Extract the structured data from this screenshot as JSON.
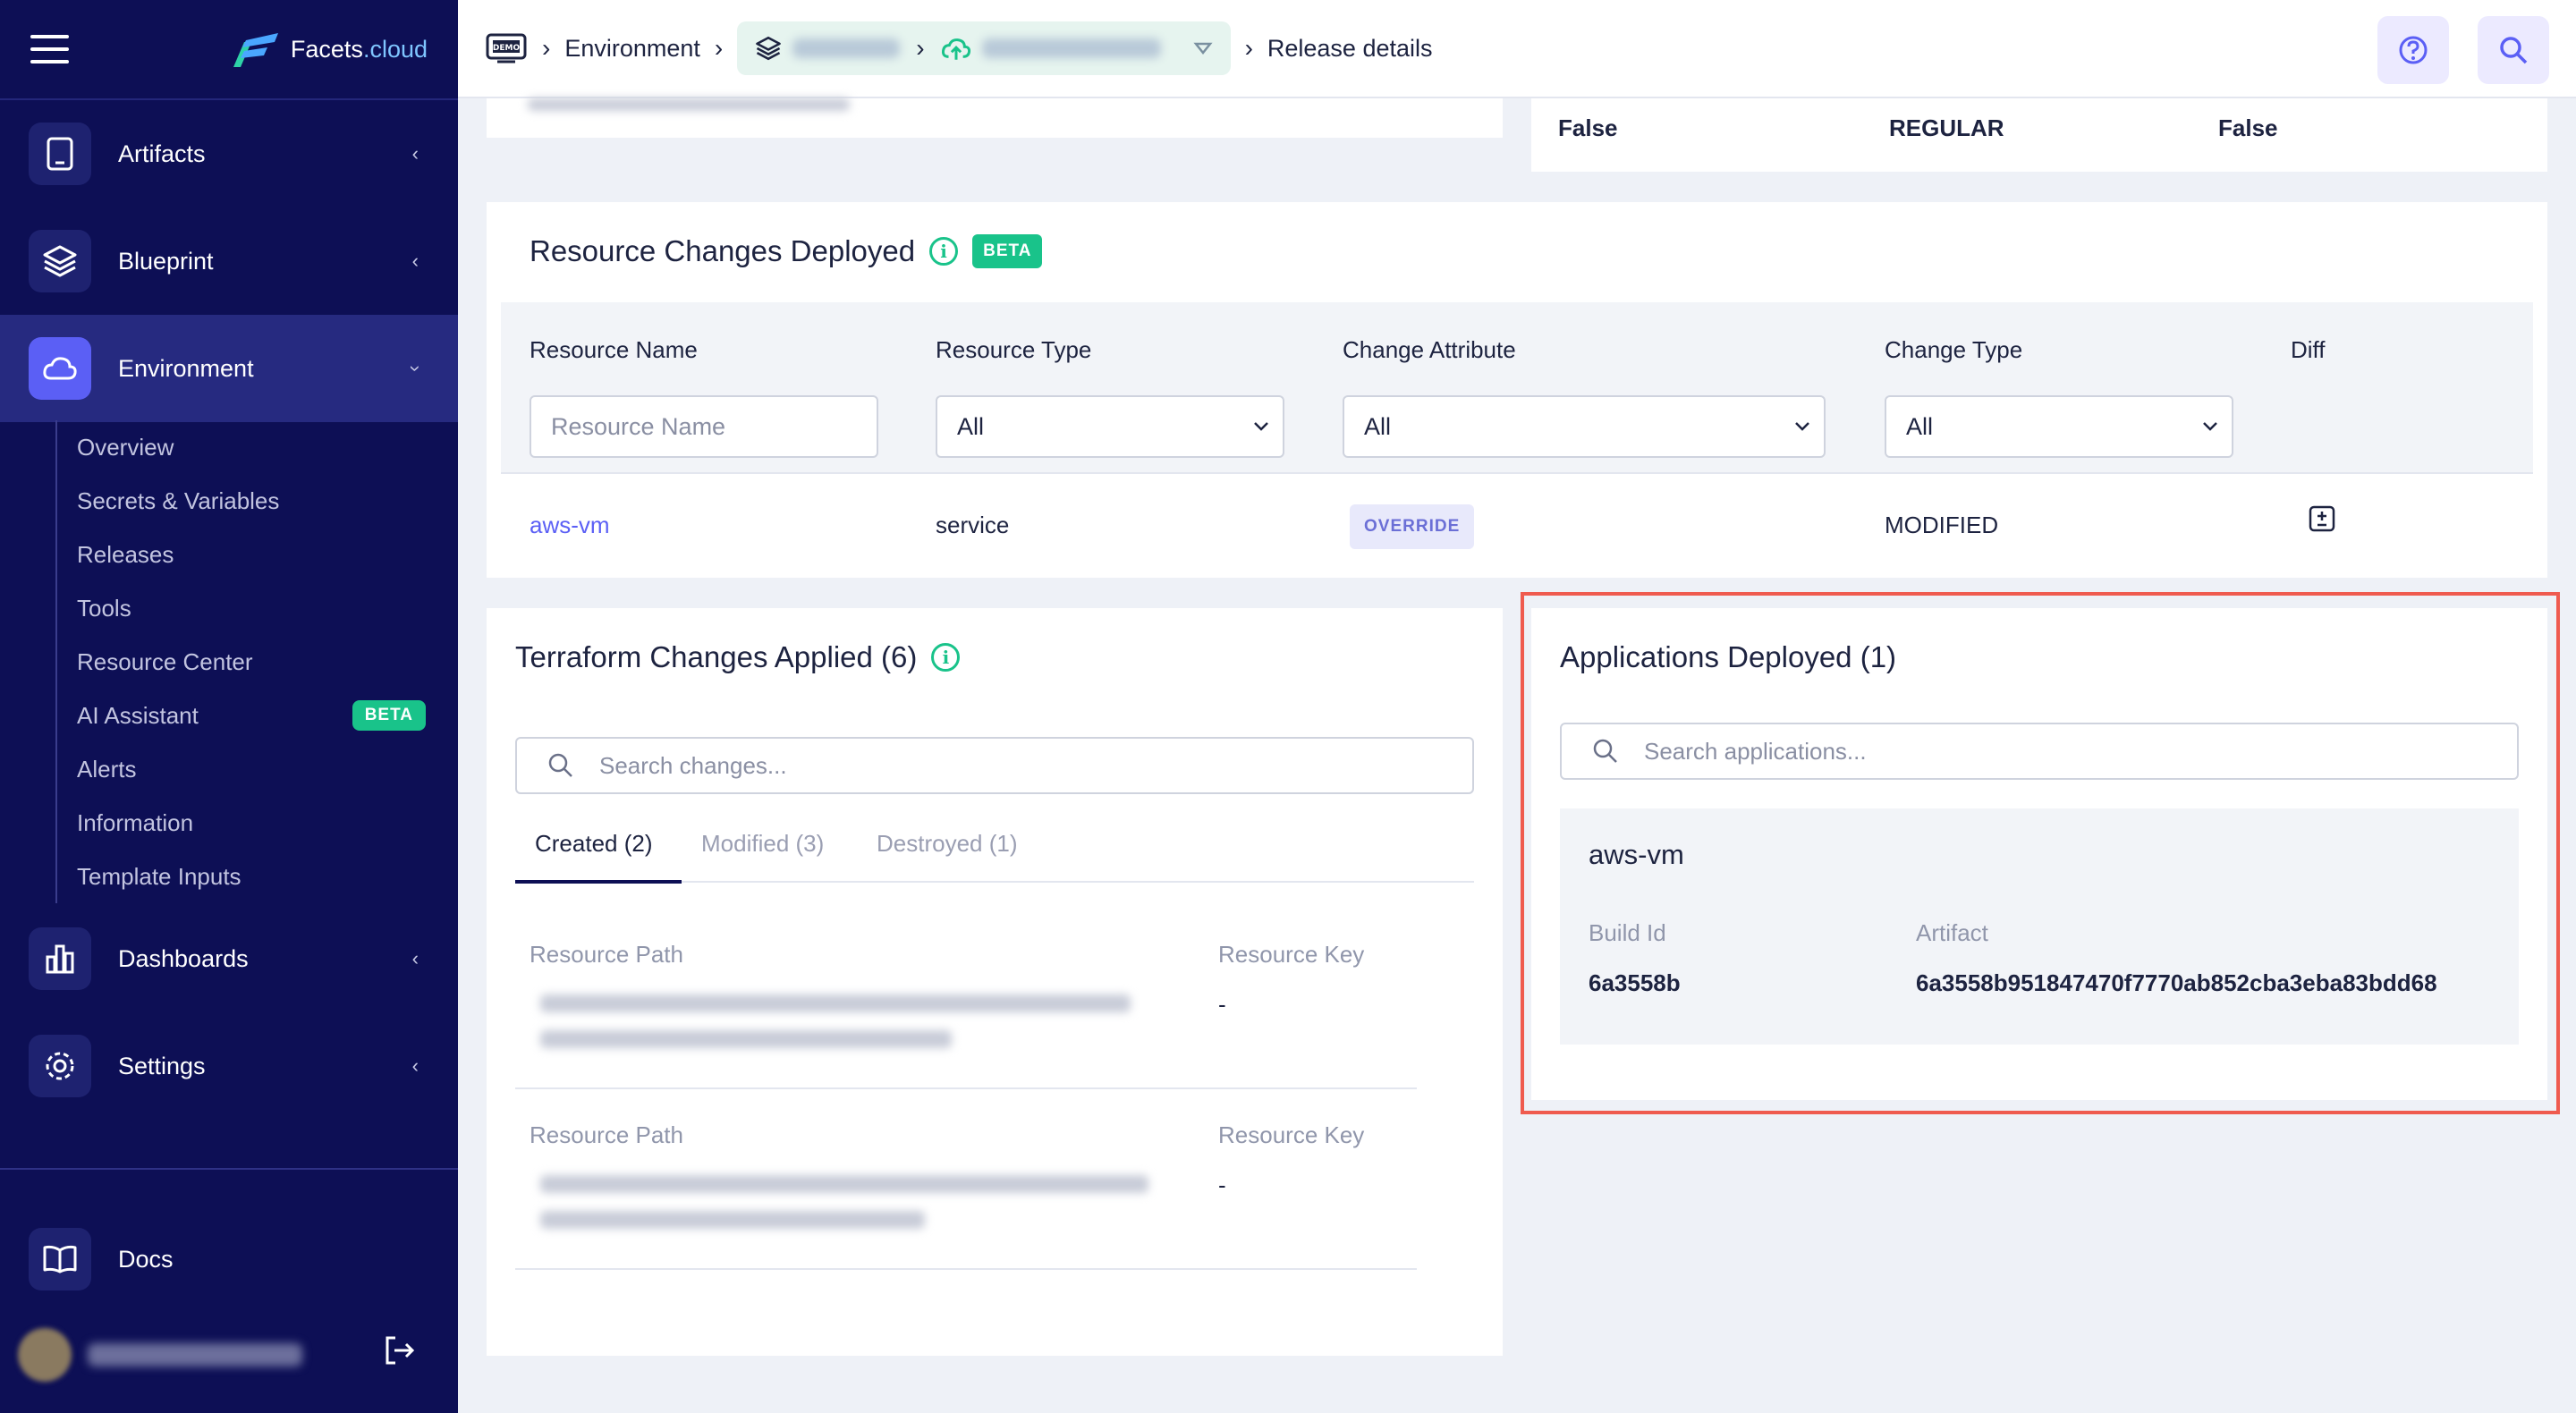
{
  "sidebar": {
    "logo": {
      "name": "Facets",
      "suffix": ".cloud"
    },
    "nav": [
      {
        "label": "Artifacts",
        "icon": "tablet-icon"
      },
      {
        "label": "Blueprint",
        "icon": "layers-icon"
      },
      {
        "label": "Environment",
        "icon": "cloud-icon"
      },
      {
        "label": "Dashboards",
        "icon": "bar-chart-icon"
      },
      {
        "label": "Settings",
        "icon": "gear-icon"
      },
      {
        "label": "Docs",
        "icon": "book-icon"
      }
    ],
    "subnav": [
      {
        "label": "Overview"
      },
      {
        "label": "Secrets & Variables"
      },
      {
        "label": "Releases"
      },
      {
        "label": "Tools"
      },
      {
        "label": "Resource Center"
      },
      {
        "label": "AI Assistant",
        "badge": "BETA"
      },
      {
        "label": "Alerts"
      },
      {
        "label": "Information"
      },
      {
        "label": "Template Inputs"
      }
    ]
  },
  "header": {
    "crumb_environment": "Environment",
    "crumb_release": "Release details"
  },
  "top_right_values": {
    "v1": "False",
    "v2": "REGULAR",
    "v3": "False"
  },
  "resource_changes": {
    "title": "Resource Changes Deployed",
    "badge": "BETA",
    "columns": {
      "name": "Resource Name",
      "type": "Resource Type",
      "attribute": "Change Attribute",
      "change_type": "Change Type",
      "diff": "Diff"
    },
    "filters": {
      "name_placeholder": "Resource Name",
      "type_value": "All",
      "attribute_value": "All",
      "change_type_value": "All"
    },
    "rows": [
      {
        "name": "aws-vm",
        "type": "service",
        "attribute": "OVERRIDE",
        "change_type": "MODIFIED"
      }
    ]
  },
  "terraform": {
    "title": "Terraform Changes Applied (6)",
    "search_placeholder": "Search changes...",
    "tabs": [
      "Created (2)",
      "Modified (3)",
      "Destroyed (1)"
    ],
    "path_label": "Resource Path",
    "key_label": "Resource Key",
    "rows": [
      {
        "key": "-"
      },
      {
        "key": "-"
      }
    ]
  },
  "applications": {
    "title": "Applications Deployed (1)",
    "search_placeholder": "Search applications...",
    "app": {
      "name": "aws-vm",
      "build_label": "Build Id",
      "artifact_label": "Artifact",
      "build_id": "6a3558b",
      "artifact": "6a3558b951847470f7770ab852cba3eba83bdd68"
    }
  },
  "colors": {
    "sidebar_bg": "#0d0f55",
    "active_accent": "#5b5ff5",
    "beta_green": "#19c38a",
    "highlight_red": "#ef5b4f",
    "link_purple": "#5b5ff5"
  }
}
